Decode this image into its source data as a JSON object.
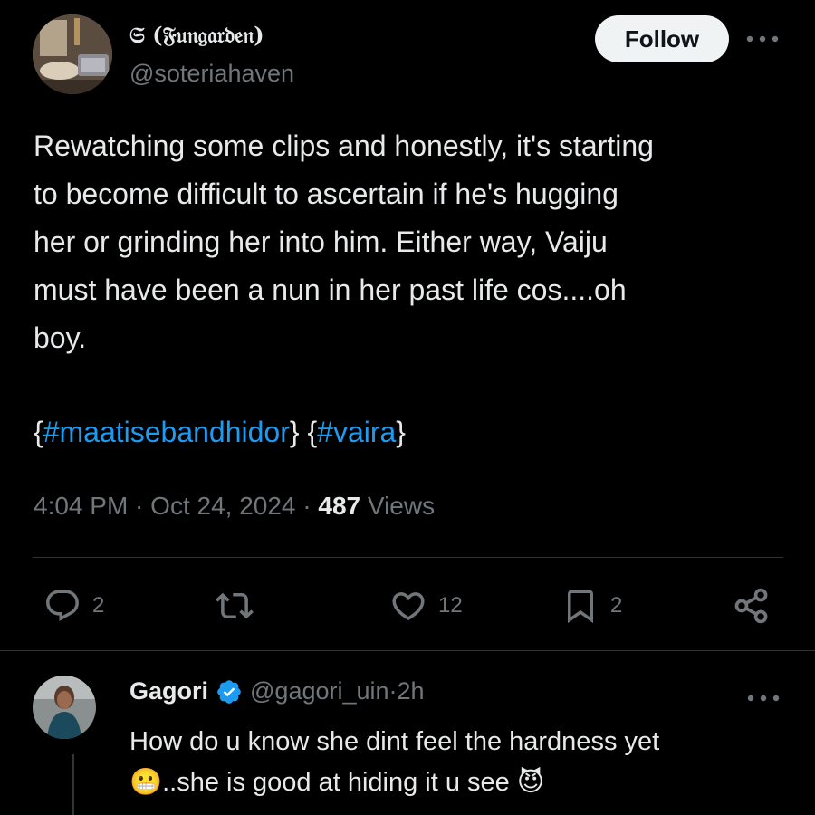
{
  "author": {
    "display_name": "𝔖 (𝔉𝔲𝔫𝔤𝔞𝔯𝔡𝔢𝔫)",
    "handle": "@soteriahaven"
  },
  "follow_label": "Follow",
  "tweet": {
    "text": "Rewatching some clips and honestly, it's starting\nto become difficult to ascertain if he's hugging\nher or grinding her into him. Either way, Vaiju\nmust have been a nun in her past life cos....oh\nboy.",
    "hashtags": {
      "open1": "{",
      "tag1": "#maatisebandhidor",
      "close1": "}",
      "open2": "{",
      "tag2": "#vaira",
      "close2": "}"
    },
    "time": "4:04 PM",
    "sep1": " · ",
    "date": "Oct 24, 2024",
    "sep2": " · ",
    "views_count": "487",
    "views_label": "Views"
  },
  "actions": {
    "replies": "2",
    "likes": "12",
    "bookmarks": "2"
  },
  "reply": {
    "name": "Gagori",
    "handle": "@gagori_uin",
    "sep": " · ",
    "time": "2h",
    "text_line1": "How do u know she dint feel the hardness yet",
    "emoji1": "😬",
    "text_line2": "..she is good at hiding it u see ",
    "emoji2": "😈"
  },
  "colors": {
    "background": "#000000",
    "text": "#e7e9ea",
    "secondary": "#71767b",
    "link": "#1d9bf0",
    "verified": "#1d9bf0",
    "divider": "#2f3336"
  },
  "icons": [
    "more-icon",
    "reply-icon",
    "retweet-icon",
    "like-icon",
    "bookmark-icon",
    "share-icon",
    "verified-badge-icon"
  ]
}
